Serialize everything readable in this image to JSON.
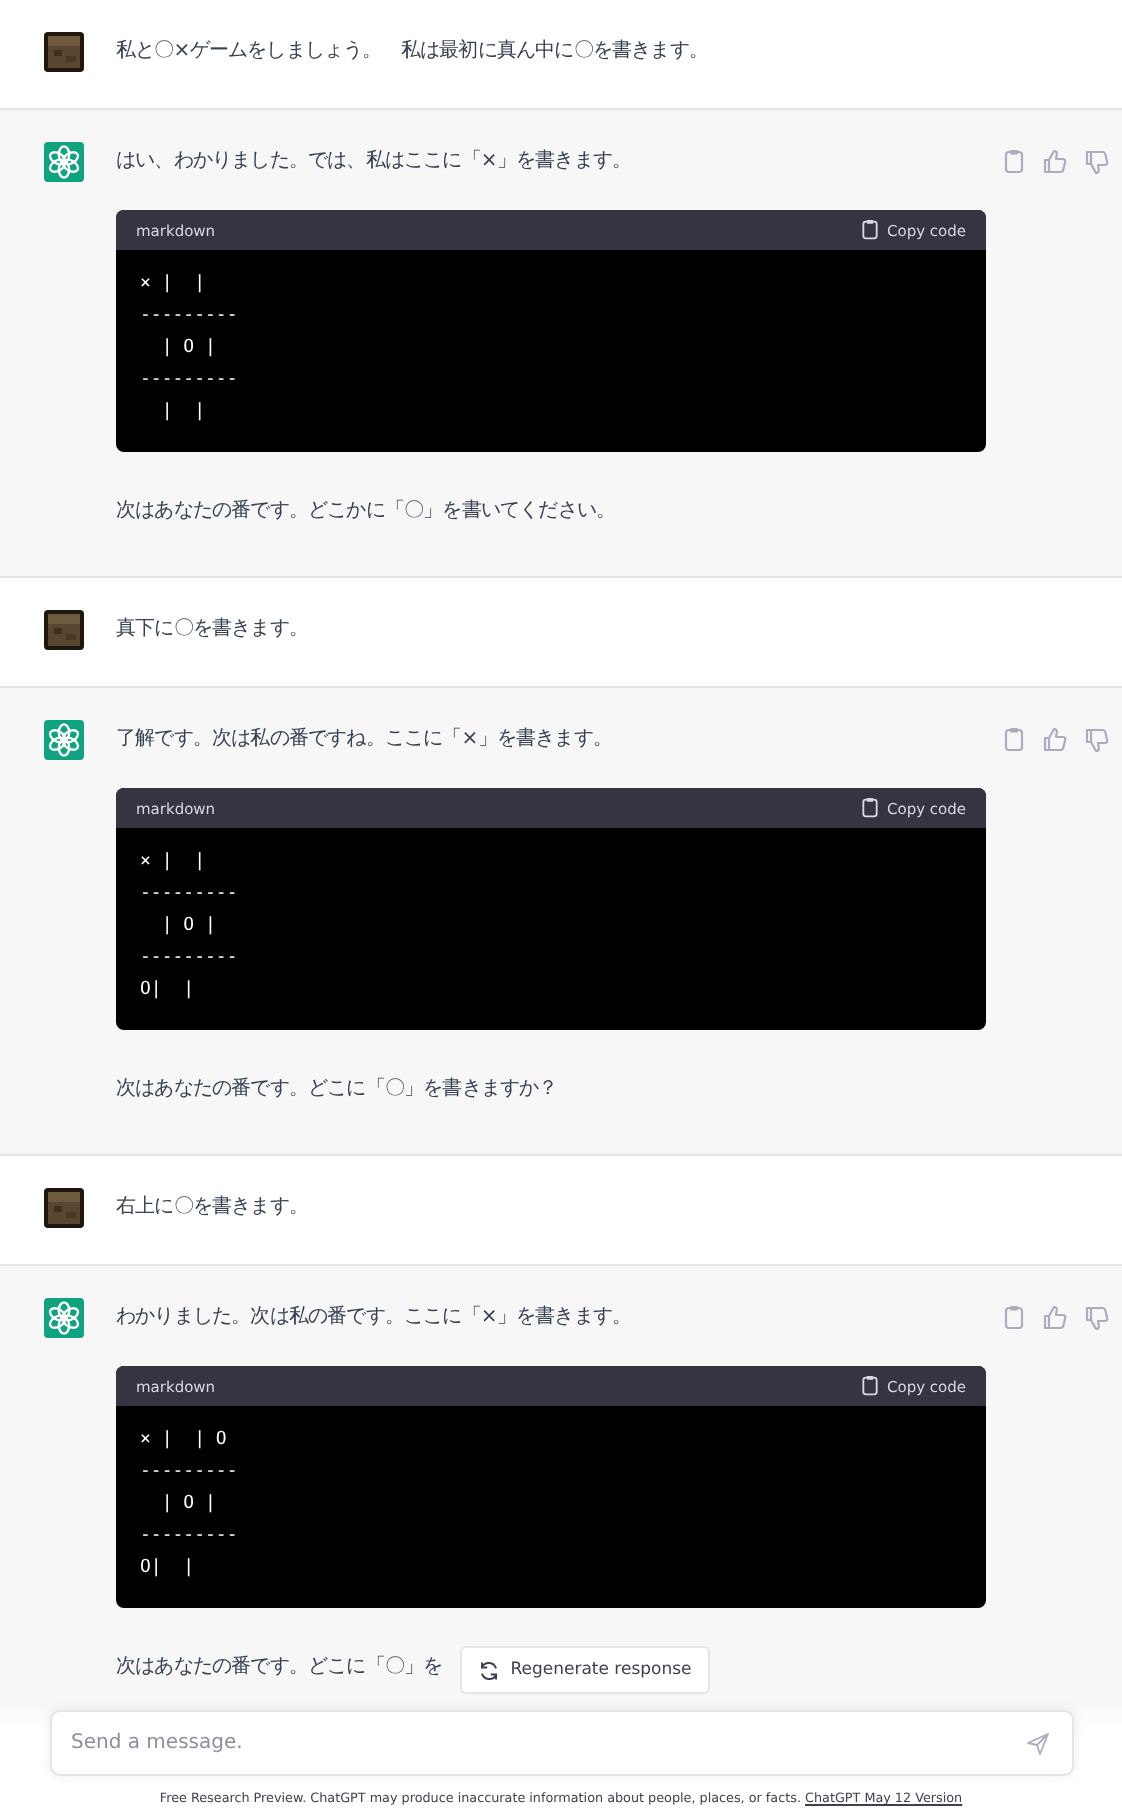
{
  "messages": [
    {
      "kind": "user",
      "text": "私と〇×ゲームをしましょう。　私は最初に真ん中に〇を書きます。"
    },
    {
      "kind": "assistant",
      "text": "はい、わかりました。では、私はここに「×」を書きます。",
      "code": {
        "language": "markdown",
        "copy_label": "Copy code",
        "lines": [
          "× |  |",
          "---------",
          "  | O |",
          "---------",
          "  |  |"
        ]
      },
      "followup": "次はあなたの番です。どこかに「〇」を書いてください。"
    },
    {
      "kind": "user",
      "text": "真下に〇を書きます。"
    },
    {
      "kind": "assistant",
      "text": "了解です。次は私の番ですね。ここに「×」を書きます。",
      "code": {
        "language": "markdown",
        "copy_label": "Copy code",
        "lines": [
          "× |  |",
          "---------",
          "  | O |",
          "---------",
          "O|  |"
        ]
      },
      "followup": "次はあなたの番です。どこに「〇」を書きますか？"
    },
    {
      "kind": "user",
      "text": "右上に〇を書きます。"
    },
    {
      "kind": "assistant",
      "text": "わかりました。次は私の番です。ここに「×」を書きます。",
      "code": {
        "language": "markdown",
        "copy_label": "Copy code",
        "lines": [
          "× |  | O",
          "---------",
          "  | O |",
          "---------",
          "O|  |"
        ]
      },
      "followup": "次はあなたの番です。どこに「〇」を"
    }
  ],
  "regenerate_label": "Regenerate response",
  "composer": {
    "placeholder": "Send a message."
  },
  "footer": {
    "text": "Free Research Preview. ChatGPT may produce inaccurate information about people, places, or facts.",
    "link": "ChatGPT May 12 Version"
  }
}
